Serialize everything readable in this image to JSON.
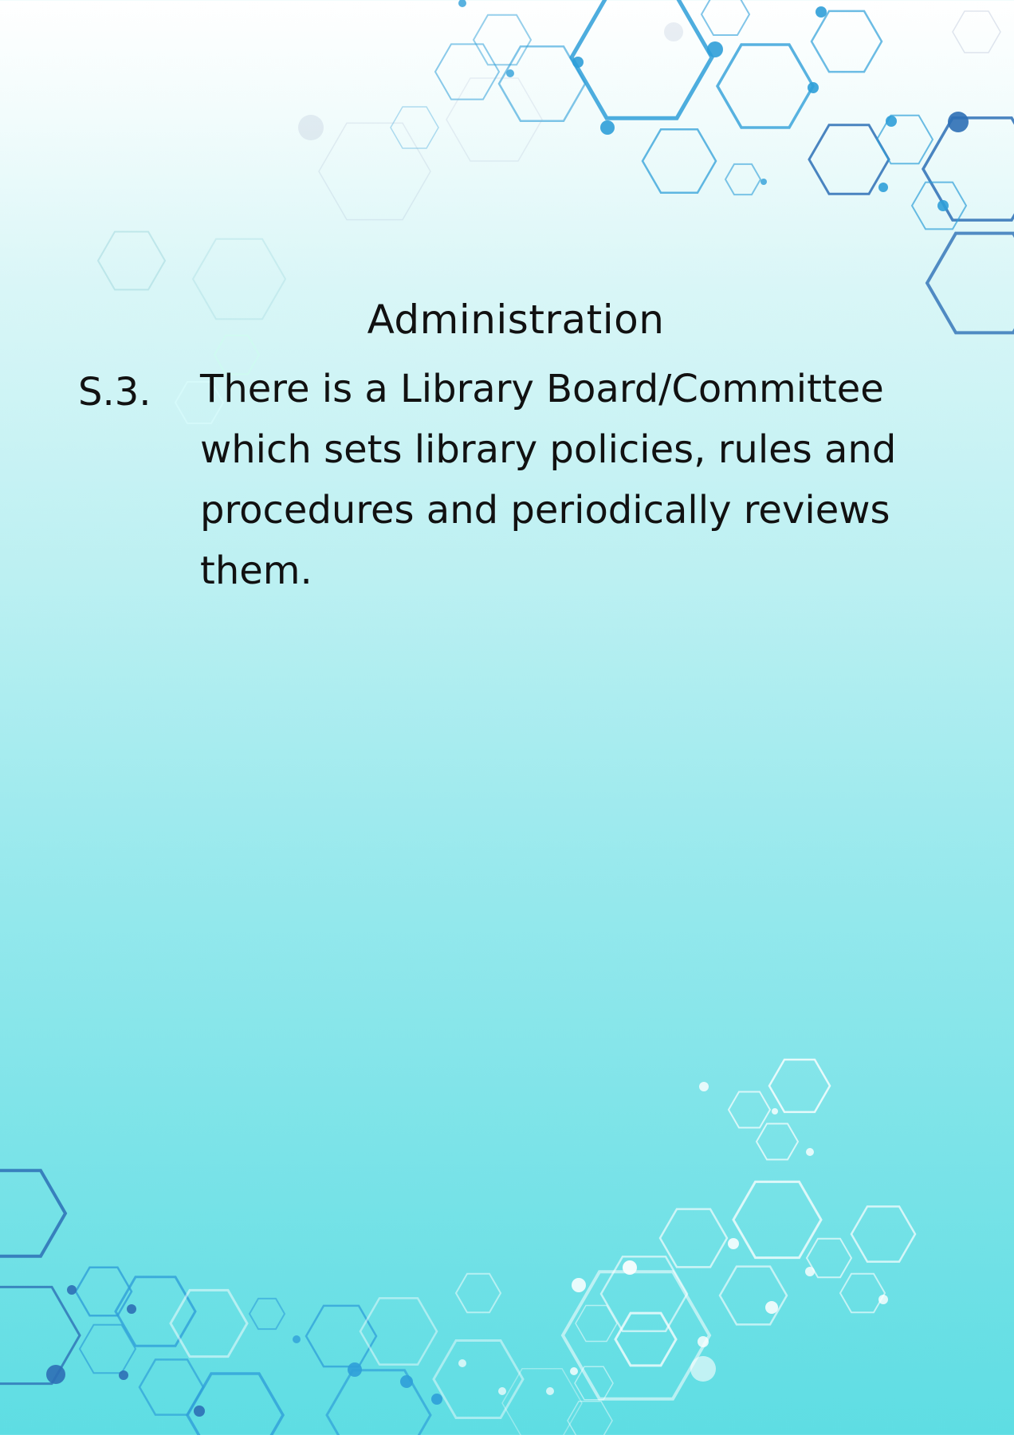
{
  "page": {
    "heading": "Administration",
    "standard": {
      "number": "S.3.",
      "text": "There is a Library Board/Committee which sets library policies, rules and procedures and periodically reviews them."
    }
  },
  "theme": {
    "decor": "hexagon-network-pattern",
    "hex_blue": "#2f9fd8",
    "hex_dark_blue": "#2d6fb5",
    "hex_light": "#ffffff",
    "background_top": "#ffffff",
    "background_bottom": "#5edde3"
  }
}
